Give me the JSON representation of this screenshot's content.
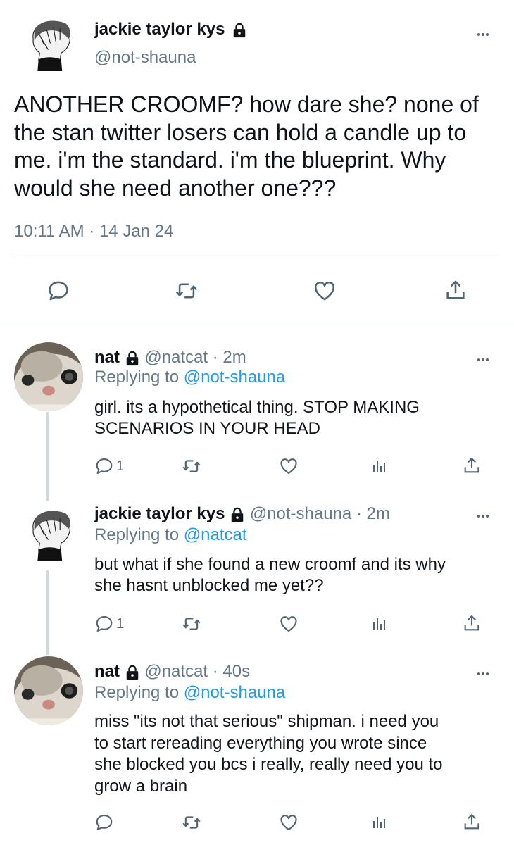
{
  "main_tweet": {
    "display_name": "jackie taylor kys",
    "handle": "@not-shauna",
    "text_lines": [
      "ANOTHER CROOMF? how dare she? none of",
      "the stan twitter losers can hold a candle up to",
      "me. i'm the standard. i'm the blueprint. Why",
      "would she need another one???"
    ],
    "timestamp": "10:11 AM · 14 Jan 24"
  },
  "replies": [
    {
      "display_name": "nat",
      "handle_time": "@natcat · 2m",
      "replying_prefix": "Replying to ",
      "replying_to": "@not-shauna",
      "text_lines": [
        "girl. its a hypothetical thing. STOP MAKING",
        "SCENARIOS IN YOUR HEAD"
      ],
      "reply_count": "1"
    },
    {
      "display_name": "jackie taylor kys",
      "handle_time": "@not-shauna · 2m",
      "replying_prefix": "Replying to ",
      "replying_to": "@natcat",
      "text_lines": [
        "but what if she found a new croomf and its why",
        "she hasnt unblocked me yet??"
      ],
      "reply_count": "1"
    },
    {
      "display_name": "nat",
      "handle_time": "@natcat · 40s",
      "replying_prefix": "Replying to ",
      "replying_to": "@not-shauna",
      "text_lines": [
        "miss \"its not that serious\" shipman. i need you",
        "to start rereading everything you wrote since",
        "she blocked you bcs i really, really need you to",
        "grow a brain"
      ],
      "reply_count": ""
    }
  ],
  "colors": {
    "link": "#1d9bf0",
    "secondary": "#657786",
    "text": "#0f1419"
  },
  "icons": [
    "lock-icon",
    "more-icon",
    "reply-icon",
    "retweet-icon",
    "like-icon",
    "analytics-icon",
    "share-icon"
  ]
}
